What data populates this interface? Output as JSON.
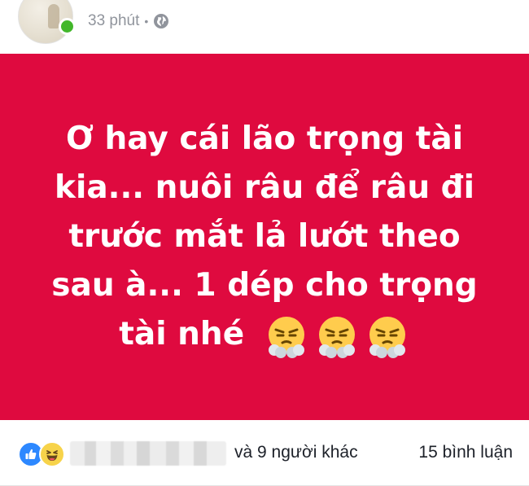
{
  "header": {
    "timestamp": "33 phút",
    "separator": "•",
    "privacy_icon": "globe-icon",
    "online_status_color": "#42b72a"
  },
  "post": {
    "background_color": "#df0a3f",
    "text_color": "#ffffff",
    "text": "Ơ hay cái lão trọng tài kia... nuôi râu để râu đi trước mắt lả lướt theo sau à... 1 dép cho trọng tài nhé",
    "emoji": [
      "face-with-steam-from-nose",
      "face-with-steam-from-nose",
      "face-with-steam-from-nose"
    ]
  },
  "reactions": {
    "icons": [
      "like-icon",
      "haha-icon"
    ],
    "others_text": "và 9 người khác",
    "comments_text": "15 bình luận"
  }
}
